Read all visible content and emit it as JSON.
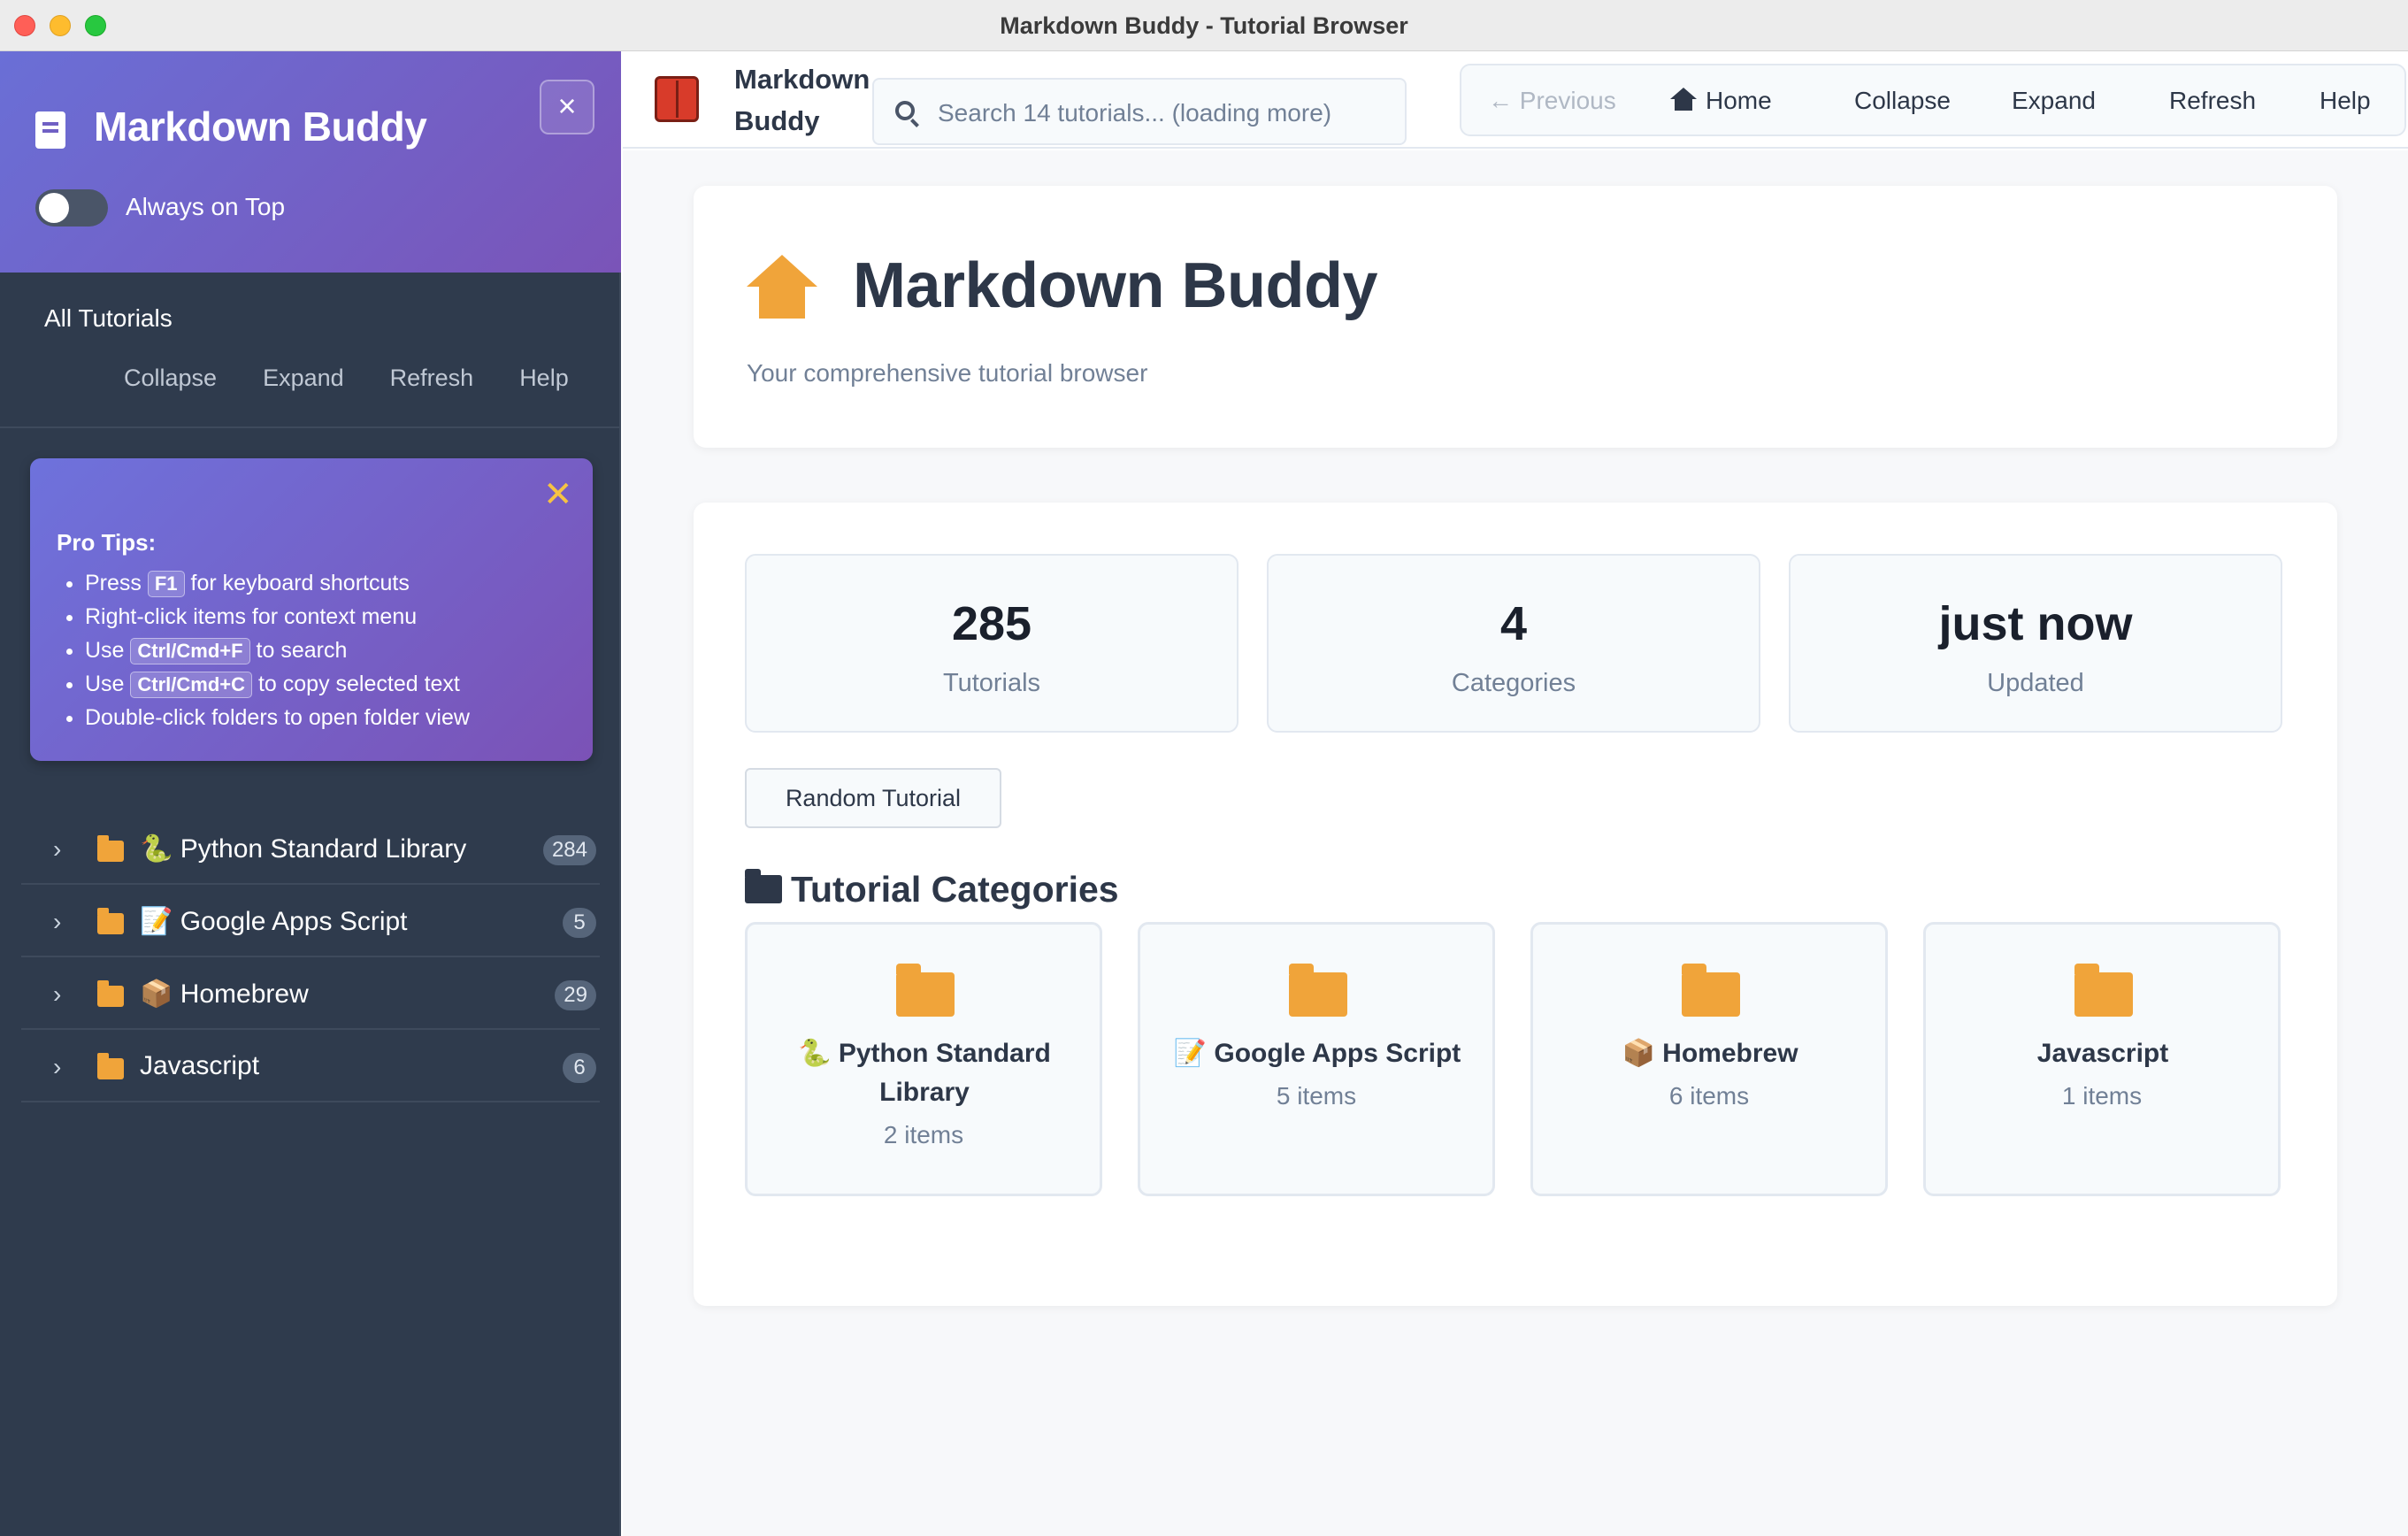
{
  "window": {
    "title": "Markdown Buddy - Tutorial Browser"
  },
  "sidebar": {
    "title": "Markdown Buddy",
    "close_label": "×",
    "always_on_top": {
      "label": "Always on Top",
      "enabled": false
    },
    "section_title": "All Tutorials",
    "actions": [
      "Collapse",
      "Expand",
      "Refresh",
      "Help"
    ],
    "pro_tips": {
      "close_label": "✕",
      "title": "Pro Tips:",
      "tips": [
        {
          "before": "Press ",
          "kbd": "F1",
          "after": " for keyboard shortcuts"
        },
        {
          "before": "Right-click items for context menu",
          "kbd": "",
          "after": ""
        },
        {
          "before": "Use ",
          "kbd": "Ctrl/Cmd+F",
          "after": " to search"
        },
        {
          "before": "Use ",
          "kbd": "Ctrl/Cmd+C",
          "after": " to copy selected text"
        },
        {
          "before": "Double-click folders to open folder view",
          "kbd": "",
          "after": ""
        }
      ]
    },
    "tree": [
      {
        "label": "🐍 Python Standard Library",
        "count": "284"
      },
      {
        "label": "📝 Google Apps Script",
        "count": "5"
      },
      {
        "label": "📦 Homebrew",
        "count": "29"
      },
      {
        "label": "Javascript",
        "count": "6"
      }
    ]
  },
  "toolbar": {
    "brand": "Markdown Buddy",
    "search_placeholder": "Search 14 tutorials... (loading more)",
    "previous_label": "← Previous",
    "home_label": "Home",
    "collapse_label": "Collapse",
    "expand_label": "Expand",
    "refresh_label": "Refresh",
    "help_label": "Help"
  },
  "hero": {
    "title": "Markdown Buddy",
    "subtitle": "Your comprehensive tutorial browser"
  },
  "stats": [
    {
      "value": "285",
      "label": "Tutorials"
    },
    {
      "value": "4",
      "label": "Categories"
    },
    {
      "value": "just now",
      "label": "Updated"
    }
  ],
  "random_button": "Random Tutorial",
  "categories_title": "Tutorial Categories",
  "categories": [
    {
      "name": "🐍 Python Standard Library",
      "count": "2 items"
    },
    {
      "name": "📝 Google Apps Script",
      "count": "5 items"
    },
    {
      "name": "📦 Homebrew",
      "count": "6 items"
    },
    {
      "name": "Javascript",
      "count": "1 items"
    }
  ],
  "colors": {
    "accent_folder": "#f0a43a",
    "sidebar_bg": "#2f3b4d",
    "header_gradient_start": "#6a6fd6",
    "header_gradient_end": "#7a54b8"
  }
}
